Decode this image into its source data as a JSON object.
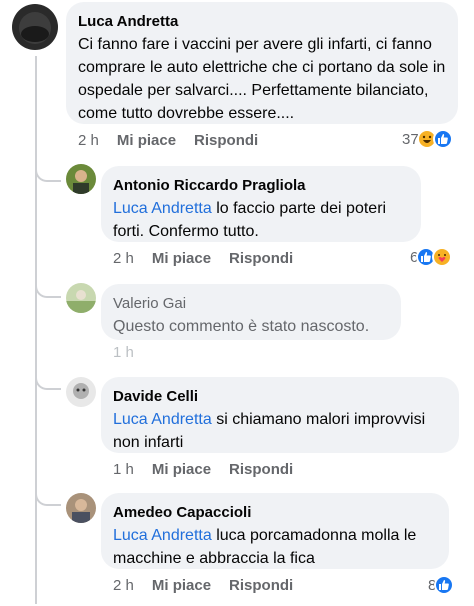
{
  "comments": [
    {
      "author": "Luca Andretta",
      "text": "Ci fanno fare i vaccini per avere gli infarti, ci fanno comprare le auto elettriche che ci portano da sole in ospedale per salvarci.... Perfettamente bilanciato, come tutto dovrebbe essere....",
      "time": "2 h",
      "like": "Mi piace",
      "reply": "Rispondi",
      "reaction_count": "37",
      "reactions": [
        "haha-icon",
        "like-icon"
      ]
    },
    {
      "author": "Antonio Riccardo Pragliola",
      "mention": "Luca Andretta",
      "text": " lo faccio parte dei poteri forti. Confermo tutto.",
      "time": "2 h",
      "like": "Mi piace",
      "reply": "Rispondi",
      "reaction_count": "6",
      "reactions": [
        "like-icon",
        "care-icon"
      ]
    },
    {
      "author": "Valerio Gai",
      "text": "Questo commento è stato nascosto.",
      "time": "1 h"
    },
    {
      "author": "Davide Celli",
      "mention": "Luca Andretta",
      "text": " si chiamano malori improvvisi non infarti",
      "time": "1 h",
      "like": "Mi piace",
      "reply": "Rispondi"
    },
    {
      "author": "Amedeo Capaccioli",
      "mention": "Luca Andretta",
      "text": " luca porcamadonna molla le macchine e abbraccia la fica",
      "time": "2 h",
      "like": "Mi piace",
      "reply": "Rispondi",
      "reaction_count": "8",
      "reactions": [
        "like-icon"
      ]
    }
  ],
  "colors": {
    "bubble": "#f0f2f5",
    "mention": "#216fdb",
    "muted": "#65676b",
    "like_blue": "#1877f2",
    "haha_yellow": "#f7b125"
  }
}
